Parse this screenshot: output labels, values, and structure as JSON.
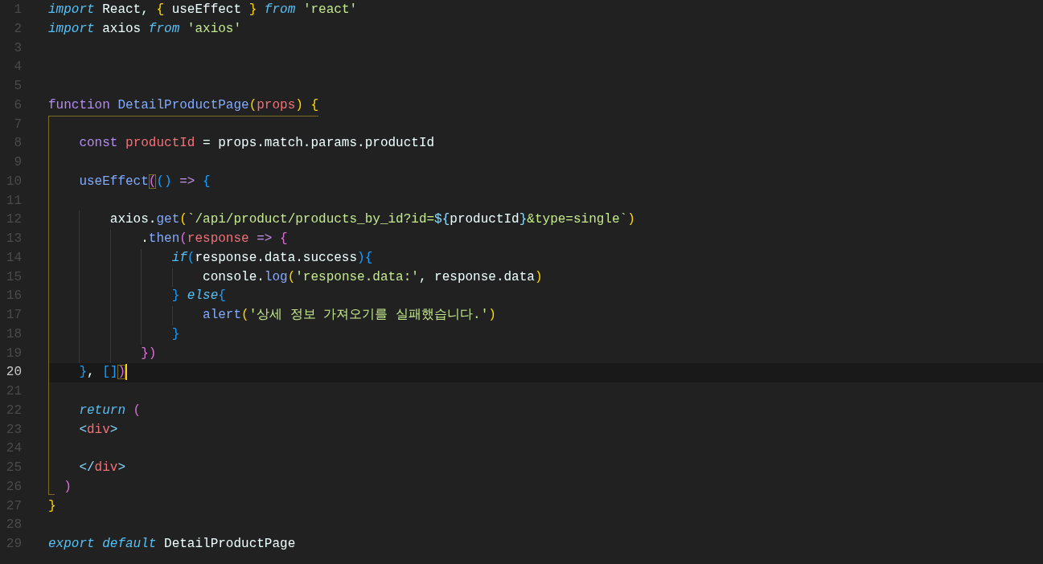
{
  "editor": {
    "lines": [
      {
        "number": "1",
        "current": false,
        "tokens": [
          {
            "kind": "kw",
            "text": "import"
          },
          {
            "kind": "plain",
            "text": " React, "
          },
          {
            "kind": "b1",
            "text": "{"
          },
          {
            "kind": "plain",
            "text": " useEffect "
          },
          {
            "kind": "b1",
            "text": "}"
          },
          {
            "kind": "kw",
            "text": " from"
          },
          {
            "kind": "str",
            "text": " 'react'"
          }
        ]
      },
      {
        "number": "2",
        "current": false,
        "tokens": [
          {
            "kind": "kw",
            "text": "import"
          },
          {
            "kind": "plain",
            "text": " axios "
          },
          {
            "kind": "kw",
            "text": "from"
          },
          {
            "kind": "str",
            "text": " 'axios'"
          }
        ]
      },
      {
        "number": "3",
        "current": false
      },
      {
        "number": "4",
        "current": false
      },
      {
        "number": "5",
        "current": false
      },
      {
        "number": "6",
        "current": false,
        "tokens": [
          {
            "kind": "decl",
            "text": "function"
          },
          {
            "kind": "fn",
            "text": " DetailProductPage"
          },
          {
            "kind": "b1",
            "text": "("
          },
          {
            "kind": "var",
            "text": "props"
          },
          {
            "kind": "b1",
            "text": ")"
          },
          {
            "kind": "b1",
            "text": " {"
          }
        ]
      },
      {
        "number": "7",
        "current": false
      },
      {
        "number": "8",
        "current": false,
        "tokens": [
          {
            "kind": "decl",
            "text": "    const"
          },
          {
            "kind": "var",
            "text": " productId"
          },
          {
            "kind": "plain",
            "text": " = props.match.params.productId"
          }
        ]
      },
      {
        "number": "9",
        "current": false
      },
      {
        "number": "10",
        "current": false,
        "tokens": [
          {
            "kind": "fn",
            "text": "    useEffect"
          },
          {
            "kind": "b2",
            "text": "(",
            "boxed": true
          },
          {
            "kind": "b3",
            "text": "()"
          },
          {
            "kind": "arrow",
            "text": " =>"
          },
          {
            "kind": "b3",
            "text": " {"
          }
        ]
      },
      {
        "number": "11",
        "current": false
      },
      {
        "number": "12",
        "current": false,
        "tokens": [
          {
            "kind": "plain",
            "text": "        axios."
          },
          {
            "kind": "fn",
            "text": "get"
          },
          {
            "kind": "b1",
            "text": "("
          },
          {
            "kind": "str",
            "text": "`/api/product/products_by_id?id="
          },
          {
            "kind": "op",
            "text": "${"
          },
          {
            "kind": "plain",
            "text": "productId"
          },
          {
            "kind": "op",
            "text": "}"
          },
          {
            "kind": "str",
            "text": "&type=single`"
          },
          {
            "kind": "b1",
            "text": ")"
          }
        ]
      },
      {
        "number": "13",
        "current": false,
        "tokens": [
          {
            "kind": "plain",
            "text": "            ."
          },
          {
            "kind": "fn",
            "text": "then"
          },
          {
            "kind": "b2",
            "text": "("
          },
          {
            "kind": "var",
            "text": "response"
          },
          {
            "kind": "arrow",
            "text": " =>"
          },
          {
            "kind": "b2",
            "text": " {"
          }
        ]
      },
      {
        "number": "14",
        "current": false,
        "tokens": [
          {
            "kind": "kw",
            "text": "                if"
          },
          {
            "kind": "b3",
            "text": "("
          },
          {
            "kind": "plain",
            "text": "response.data.success"
          },
          {
            "kind": "b3",
            "text": "){"
          }
        ]
      },
      {
        "number": "15",
        "current": false,
        "tokens": [
          {
            "kind": "plain",
            "text": "                    console."
          },
          {
            "kind": "fn",
            "text": "log"
          },
          {
            "kind": "b1",
            "text": "("
          },
          {
            "kind": "str",
            "text": "'response.data:'"
          },
          {
            "kind": "plain",
            "text": ", response.data"
          },
          {
            "kind": "b1",
            "text": ")"
          }
        ]
      },
      {
        "number": "16",
        "current": false,
        "tokens": [
          {
            "kind": "b3",
            "text": "                }"
          },
          {
            "kind": "kw",
            "text": " else"
          },
          {
            "kind": "b3",
            "text": "{"
          }
        ]
      },
      {
        "number": "17",
        "current": false,
        "tokens": [
          {
            "kind": "fn",
            "text": "                    alert"
          },
          {
            "kind": "b1",
            "text": "("
          },
          {
            "kind": "str",
            "text": "'상세 정보 가져오기를 실패했습니다.'"
          },
          {
            "kind": "b1",
            "text": ")"
          }
        ]
      },
      {
        "number": "18",
        "current": false,
        "tokens": [
          {
            "kind": "b3",
            "text": "                }"
          }
        ]
      },
      {
        "number": "19",
        "current": false,
        "tokens": [
          {
            "kind": "b2",
            "text": "            })"
          }
        ]
      },
      {
        "number": "20",
        "current": true,
        "tokens": [
          {
            "kind": "b3",
            "text": "    }"
          },
          {
            "kind": "plain",
            "text": ", "
          },
          {
            "kind": "b3",
            "text": "[]"
          },
          {
            "kind": "b2",
            "text": ")",
            "boxed": true
          }
        ]
      },
      {
        "number": "21",
        "current": false
      },
      {
        "number": "22",
        "current": false,
        "tokens": [
          {
            "kind": "kw",
            "text": "    return"
          },
          {
            "kind": "b2",
            "text": " ("
          }
        ]
      },
      {
        "number": "23",
        "current": false,
        "tokens": [
          {
            "kind": "op",
            "text": "    <"
          },
          {
            "kind": "tag",
            "text": "div"
          },
          {
            "kind": "op",
            "text": ">"
          }
        ]
      },
      {
        "number": "24",
        "current": false
      },
      {
        "number": "25",
        "current": false,
        "tokens": [
          {
            "kind": "op",
            "text": "    </"
          },
          {
            "kind": "tag",
            "text": "div"
          },
          {
            "kind": "op",
            "text": ">"
          }
        ]
      },
      {
        "number": "26",
        "current": false,
        "tokens": [
          {
            "kind": "b2",
            "text": "  )"
          }
        ]
      },
      {
        "number": "27",
        "current": false,
        "tokens": [
          {
            "kind": "b1",
            "text": "}"
          }
        ]
      },
      {
        "number": "28",
        "current": false
      },
      {
        "number": "29",
        "current": false,
        "tokens": [
          {
            "kind": "kw",
            "text": "export"
          },
          {
            "kind": "kw",
            "text": " default"
          },
          {
            "kind": "plain",
            "text": " DetailProductPage"
          }
        ]
      }
    ]
  }
}
